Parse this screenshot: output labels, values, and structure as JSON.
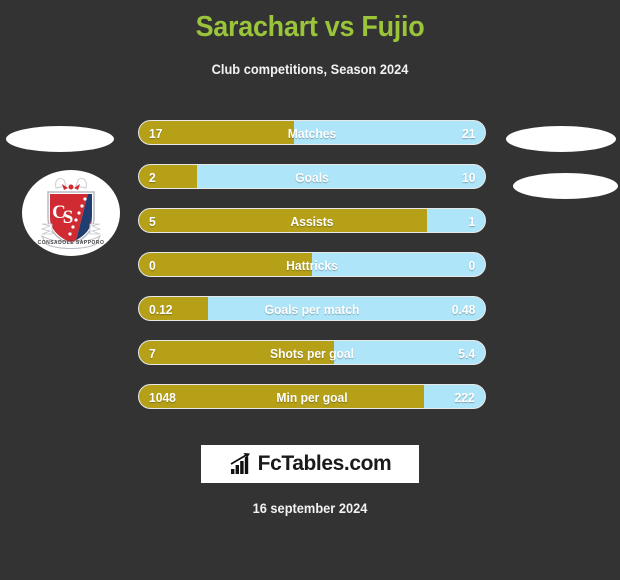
{
  "header": {
    "title": "Sarachart vs Fujio",
    "subtitle": "Club competitions, Season 2024",
    "title_color": "#9ac43a"
  },
  "badge": {
    "initials": "CS",
    "banner_text": "CONSADOLE SAPPORO",
    "colors": {
      "red": "#d02b33",
      "blue": "#1f3d6e",
      "white": "#ffffff"
    }
  },
  "colors": {
    "background": "#333333",
    "home_bar": "#b5a017",
    "away_bar": "#aee5f8",
    "bar_border": "#e8e8e8",
    "text": "#ffffff"
  },
  "footer": {
    "logo_text": "FcTables.com",
    "date": "16 september 2024"
  },
  "chart_data": {
    "type": "bar",
    "title": "Sarachart vs Fujio",
    "subtitle": "Club competitions, Season 2024",
    "orientation": "horizontal-dual",
    "legend": [
      "Sarachart",
      "Fujio"
    ],
    "categories": [
      "Matches",
      "Goals",
      "Assists",
      "Hattricks",
      "Goals per match",
      "Shots per goal",
      "Min per goal"
    ],
    "series": [
      {
        "name": "Sarachart",
        "color": "#b5a017",
        "values": [
          17,
          2,
          5,
          0,
          0.12,
          7,
          1048
        ],
        "labels": [
          "17",
          "2",
          "5",
          "0",
          "0.12",
          "7",
          "1048"
        ]
      },
      {
        "name": "Fujio",
        "color": "#aee5f8",
        "values": [
          21,
          10,
          1,
          0,
          0.48,
          5.4,
          222
        ],
        "labels": [
          "21",
          "10",
          "1",
          "0",
          "0.48",
          "5.4",
          "222"
        ]
      }
    ],
    "rows": [
      {
        "label": "Matches",
        "left_value": "17",
        "right_value": "21",
        "left_pct": 44.7
      },
      {
        "label": "Goals",
        "left_value": "2",
        "right_value": "10",
        "left_pct": 16.7
      },
      {
        "label": "Assists",
        "left_value": "5",
        "right_value": "1",
        "left_pct": 83.3
      },
      {
        "label": "Hattricks",
        "left_value": "0",
        "right_value": "0",
        "left_pct": 50.0
      },
      {
        "label": "Goals per match",
        "left_value": "0.12",
        "right_value": "0.48",
        "left_pct": 20.0
      },
      {
        "label": "Shots per goal",
        "left_value": "7",
        "right_value": "5.4",
        "left_pct": 56.5
      },
      {
        "label": "Min per goal",
        "left_value": "1048",
        "right_value": "222",
        "left_pct": 82.5
      }
    ]
  }
}
